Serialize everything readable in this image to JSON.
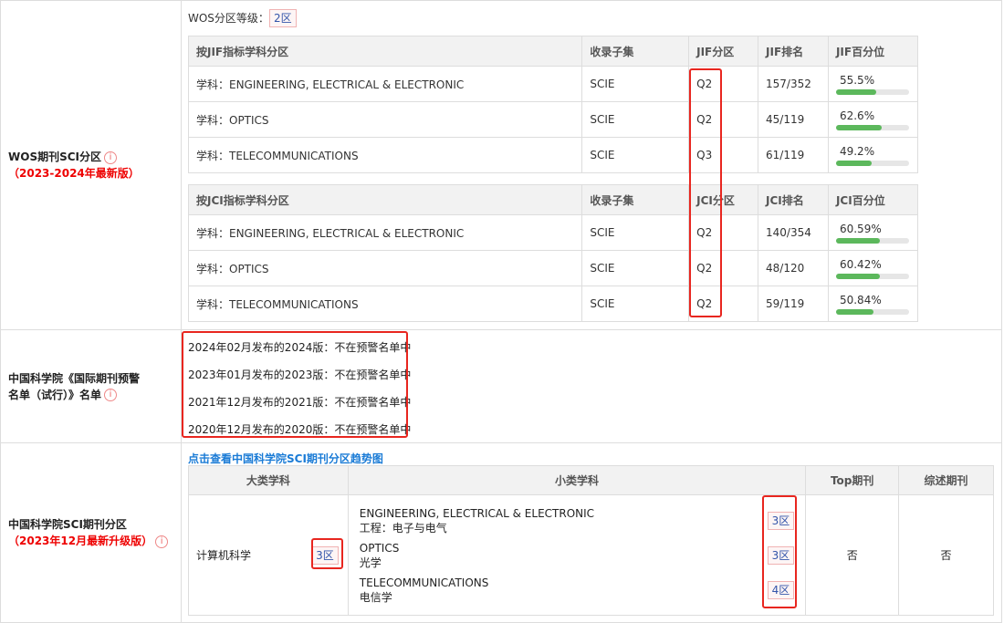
{
  "wos": {
    "label_line1": "WOS期刊SCI分区",
    "label_line2": "（2023-2024年最新版）",
    "grade_label": "WOS分区等级：",
    "grade_value": "2区",
    "jif_table": {
      "headers": [
        "按JIF指标学科分区",
        "收录子集",
        "JIF分区",
        "JIF排名",
        "JIF百分位"
      ],
      "rows": [
        {
          "subject": "学科：ENGINEERING, ELECTRICAL & ELECTRONIC",
          "subset": "SCIE",
          "quartile": "Q2",
          "rank": "157/352",
          "pct_text": "55.5%",
          "pct": 55.5
        },
        {
          "subject": "学科：OPTICS",
          "subset": "SCIE",
          "quartile": "Q2",
          "rank": "45/119",
          "pct_text": "62.6%",
          "pct": 62.6
        },
        {
          "subject": "学科：TELECOMMUNICATIONS",
          "subset": "SCIE",
          "quartile": "Q3",
          "rank": "61/119",
          "pct_text": "49.2%",
          "pct": 49.2
        }
      ]
    },
    "jci_table": {
      "headers": [
        "按JCI指标学科分区",
        "收录子集",
        "JCI分区",
        "JCI排名",
        "JCI百分位"
      ],
      "rows": [
        {
          "subject": "学科：ENGINEERING, ELECTRICAL & ELECTRONIC",
          "subset": "SCIE",
          "quartile": "Q2",
          "rank": "140/354",
          "pct_text": "60.59%",
          "pct": 60.59
        },
        {
          "subject": "学科：OPTICS",
          "subset": "SCIE",
          "quartile": "Q2",
          "rank": "48/120",
          "pct_text": "60.42%",
          "pct": 60.42
        },
        {
          "subject": "学科：TELECOMMUNICATIONS",
          "subset": "SCIE",
          "quartile": "Q2",
          "rank": "59/119",
          "pct_text": "50.84%",
          "pct": 50.84
        }
      ]
    }
  },
  "warning": {
    "label_line1": "中国科学院《国际期刊预警",
    "label_line2": "名单（试行）》名单",
    "lines": [
      "2024年02月发布的2024版：不在预警名单中",
      "2023年01月发布的2023版：不在预警名单中",
      "2021年12月发布的2021版：不在预警名单中",
      "2020年12月发布的2020版：不在预警名单中"
    ]
  },
  "cas": {
    "label_line1": "中国科学院SCI期刊分区",
    "label_line2": "（2023年12月最新升级版）",
    "link": "点击查看中国科学院SCI期刊分区趋势图",
    "headers": [
      "大类学科",
      "小类学科",
      "Top期刊",
      "综述期刊"
    ],
    "major": {
      "name": "计算机科学",
      "zone": "3区"
    },
    "minors": [
      {
        "en": "ENGINEERING, ELECTRICAL & ELECTRONIC",
        "zh": "工程：电子与电气",
        "zone": "3区"
      },
      {
        "en": "OPTICS",
        "zh": "光学",
        "zone": "3区"
      },
      {
        "en": "TELECOMMUNICATIONS",
        "zh": "电信学",
        "zone": "4区"
      }
    ],
    "top": "否",
    "review": "否"
  },
  "icons": {
    "info": "info-circle-icon"
  },
  "colors": {
    "highlight": "#e8261f",
    "bar": "#5cb85c",
    "link": "#1a7bd6",
    "accent_red": "#ee0000"
  }
}
